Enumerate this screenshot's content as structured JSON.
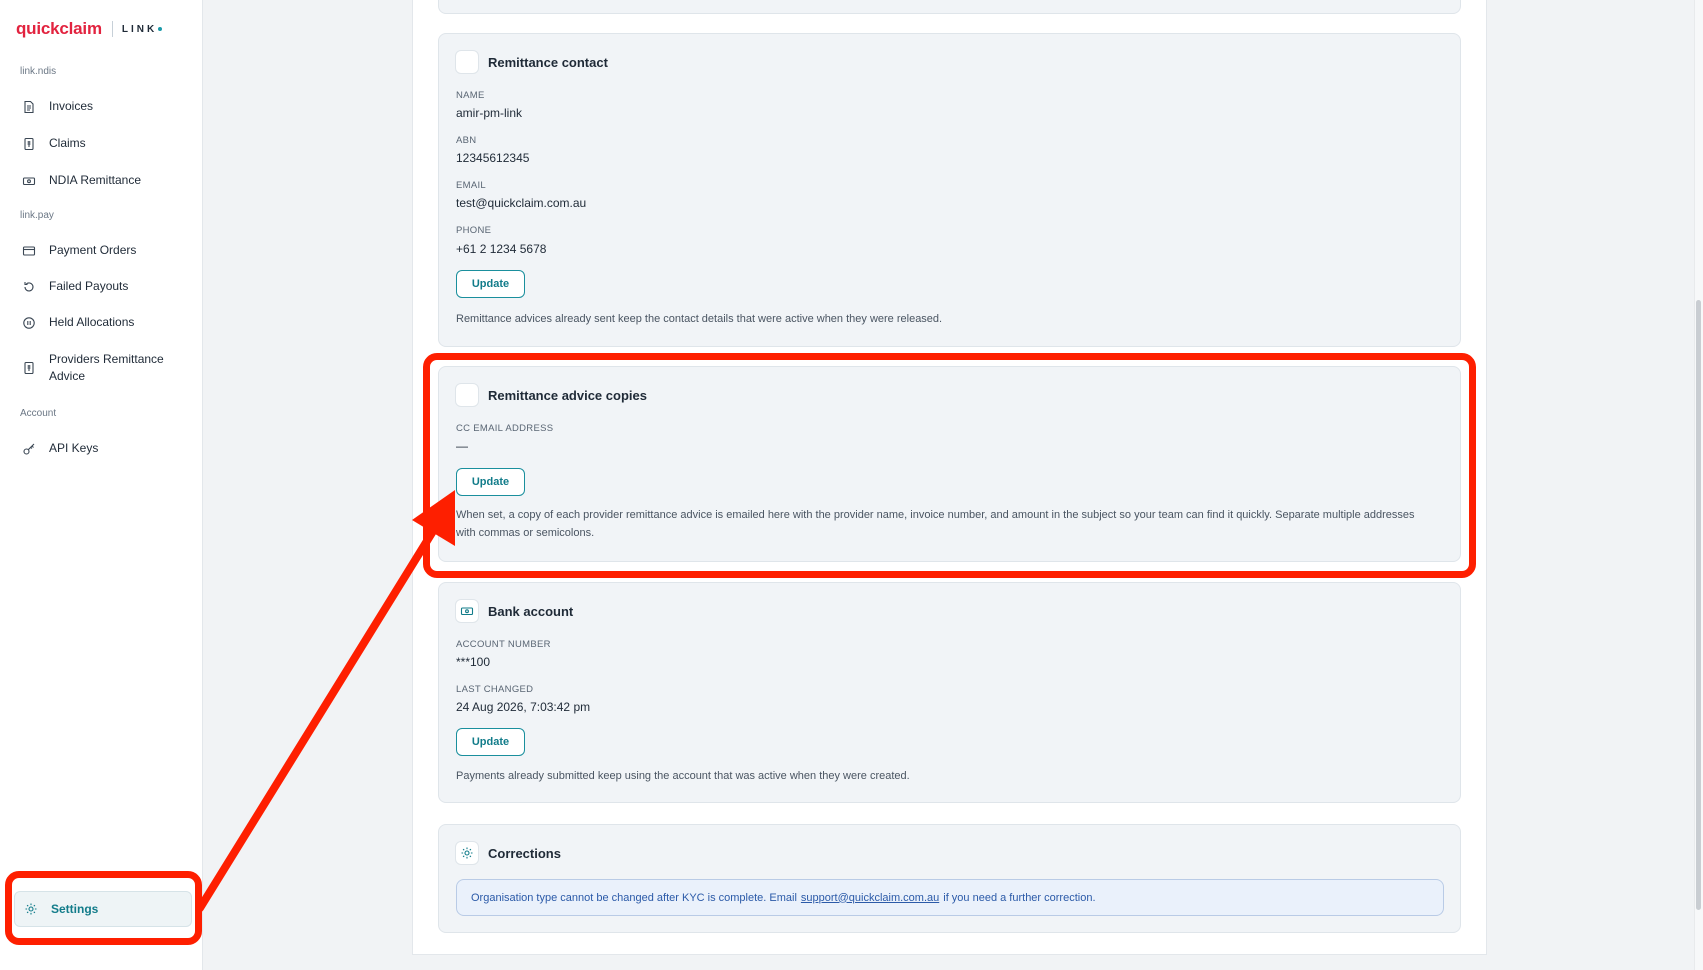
{
  "brand": {
    "name": "quickclaim",
    "product": "LINK"
  },
  "sidebar": {
    "sections": [
      {
        "title": "link.ndis",
        "items": [
          "Invoices",
          "Claims",
          "NDIA Remittance"
        ]
      },
      {
        "title": "link.pay",
        "items": [
          "Payment Orders",
          "Failed Payouts",
          "Held Allocations",
          "Providers Remittance Advice"
        ]
      },
      {
        "title": "Account",
        "items": [
          "API Keys"
        ]
      }
    ],
    "settings_label": "Settings",
    "active_item": "Settings"
  },
  "cards": {
    "remittance_contact": {
      "title": "Remittance contact",
      "name_label": "NAME",
      "name_value": "amir-pm-link",
      "abn_label": "ABN",
      "abn_value": "12345612345",
      "email_label": "EMAIL",
      "email_value": "test@quickclaim.com.au",
      "phone_label": "PHONE",
      "phone_value": "+61 2 1234 5678",
      "button": "Update",
      "note": "Remittance advices already sent keep the contact details that were active when they were released."
    },
    "remittance_copies": {
      "title": "Remittance advice copies",
      "cc_label": "CC EMAIL ADDRESS",
      "cc_value": "—",
      "button": "Update",
      "note": "When set, a copy of each provider remittance advice is emailed here with the provider name, invoice number, and amount in the subject so your team can find it quickly. Separate multiple addresses with commas or semicolons."
    },
    "bank_account": {
      "title": "Bank account",
      "account_label": "ACCOUNT NUMBER",
      "account_value": "***100",
      "changed_label": "LAST CHANGED",
      "changed_value": "24 Aug 2026, 7:03:42 pm",
      "button": "Update",
      "note": "Payments already submitted keep using the account that was active when they were created."
    },
    "corrections": {
      "title": "Corrections",
      "info_before": "Organisation type cannot be changed after KYC is complete. Email",
      "info_link": "support@quickclaim.com.au",
      "info_after": "if you need a further correction."
    }
  },
  "colors": {
    "brand": "#e2233f",
    "accent": "#127c8a",
    "annotation": "#fe1f00",
    "info_text": "#2b5aa8"
  }
}
